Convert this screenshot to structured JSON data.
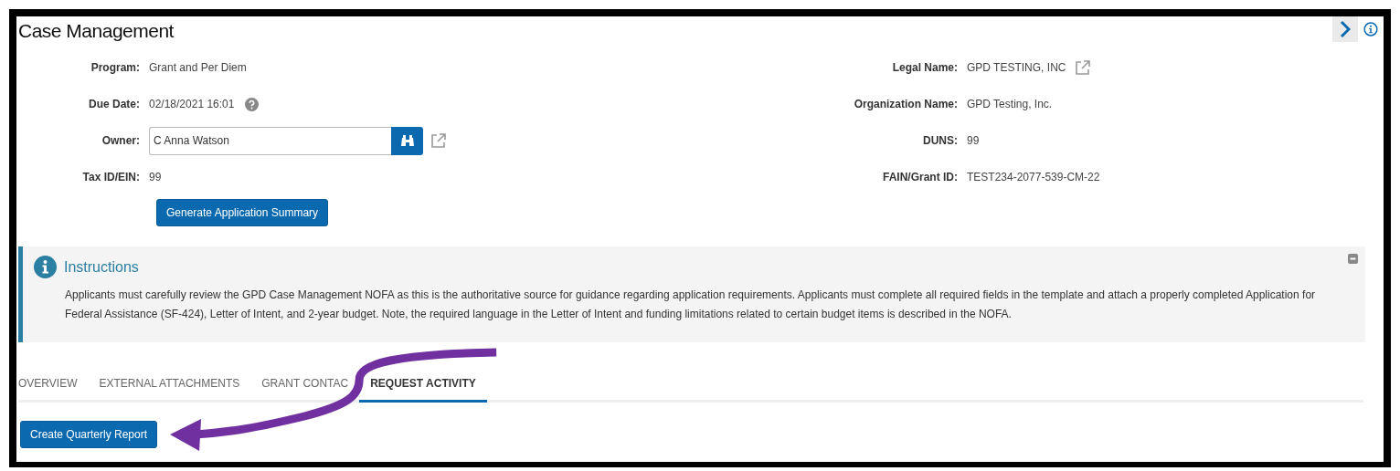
{
  "page_title": "Case Management",
  "left_fields": [
    {
      "label": "Program:",
      "kind": "text",
      "value": "Grant and Per Diem"
    },
    {
      "label": "Due Date:",
      "kind": "help",
      "value": "02/18/2021 16:01"
    },
    {
      "label": "Owner:",
      "kind": "lookup",
      "value": "C Anna Watson"
    },
    {
      "label": "Tax ID/EIN:",
      "kind": "text",
      "value": "99"
    }
  ],
  "right_fields": [
    {
      "label": "Legal Name:",
      "kind": "link",
      "value": "GPD TESTING, INC"
    },
    {
      "label": "Organization Name:",
      "kind": "text",
      "value": "GPD Testing, Inc."
    },
    {
      "label": "DUNS:",
      "kind": "text",
      "value": "99"
    },
    {
      "label": "FAIN/Grant ID:",
      "kind": "text",
      "value": "TEST234-2077-539-CM-22"
    }
  ],
  "summary_button": "Generate Application Summary",
  "instructions": {
    "title": "Instructions",
    "expanded": true,
    "body": "Applicants must carefully review the GPD Case Management NOFA as this is the authoritative source for guidance regarding application requirements. Applicants must complete all required fields in the template and attach a properly completed Application for Federal Assistance (SF-424), Letter of Intent, and 2-year budget. Note, the required language in the Letter of Intent and funding limitations related to certain budget items is described in the NOFA."
  },
  "tabs": [
    {
      "label": "OVERVIEW",
      "selected": false
    },
    {
      "label": "EXTERNAL ATTACHMENTS",
      "selected": false
    },
    {
      "label": "GRANT CONTAC",
      "selected": false
    },
    {
      "label": "REQUEST ACTIVITY",
      "selected": true
    }
  ],
  "action_button": "Create Quarterly Report"
}
